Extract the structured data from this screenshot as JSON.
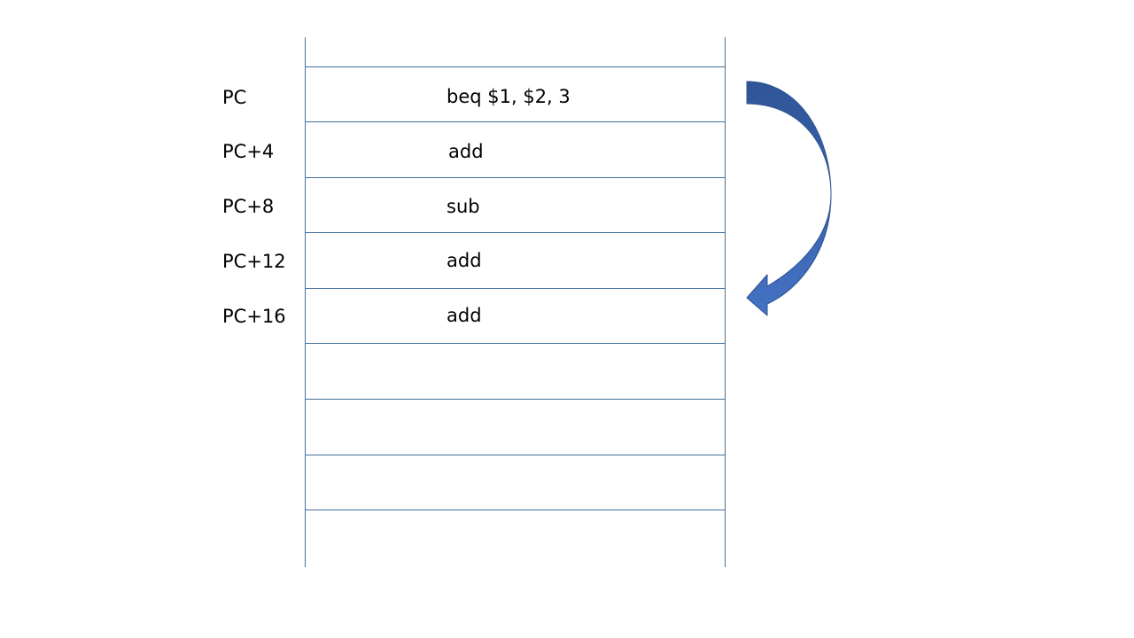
{
  "diagram": {
    "rows": [
      {
        "address": "",
        "instruction": ""
      },
      {
        "address": "PC",
        "instruction": "beq $1, $2, 3"
      },
      {
        "address": "PC+4",
        "instruction": "add"
      },
      {
        "address": "PC+8",
        "instruction": "sub"
      },
      {
        "address": "PC+12",
        "instruction": "add"
      },
      {
        "address": "PC+16",
        "instruction": "add"
      },
      {
        "address": "",
        "instruction": ""
      },
      {
        "address": "",
        "instruction": ""
      },
      {
        "address": "",
        "instruction": ""
      },
      {
        "address": "",
        "instruction": ""
      }
    ],
    "arrow": {
      "icon": "curved-arrow-icon",
      "from_row": 1,
      "to_row": 5,
      "color_top": "#2f5597",
      "color_bottom": "#4472c4",
      "outline": "#2f528f"
    },
    "line_color": "#41719c"
  }
}
